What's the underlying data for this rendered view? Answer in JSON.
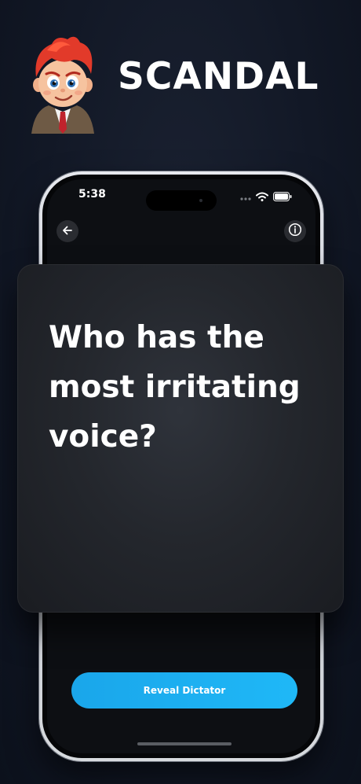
{
  "header": {
    "brand": "SCANDAL",
    "mascot_icon": "cartoon-boy-mascot-icon"
  },
  "status_bar": {
    "time": "5:38",
    "icons": [
      "signal-dots-icon",
      "wifi-icon",
      "battery-icon"
    ]
  },
  "nav": {
    "back_icon": "arrow-left-icon",
    "info_icon": "info-circle-icon"
  },
  "card": {
    "question": "Who has the most irritating voice?"
  },
  "actions": {
    "reveal_label": "Reveal Dictator"
  },
  "colors": {
    "background": "#121826",
    "card": "#24272d",
    "accent": "#1aa6ea",
    "text": "#ffffff"
  }
}
